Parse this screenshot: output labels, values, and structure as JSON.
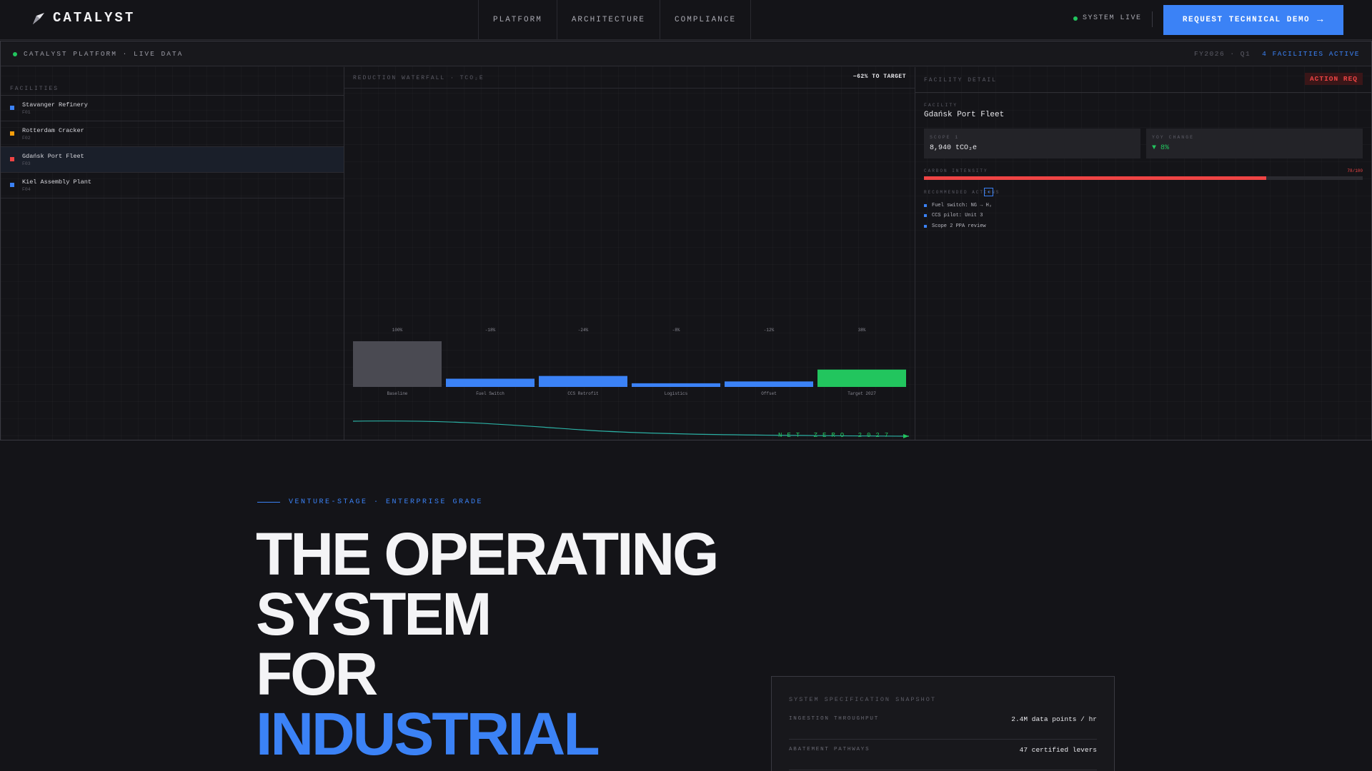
{
  "nav": {
    "brand": "CATALYST",
    "links": [
      "PLATFORM",
      "ARCHITECTURE",
      "COMPLIANCE"
    ],
    "status": "SYSTEM LIVE",
    "cta": "REQUEST TECHNICAL DEMO",
    "cta_arrow": "→"
  },
  "dashboard": {
    "title": "CATALYST PLATFORM · LIVE DATA",
    "period": "FY2026 · Q1",
    "active": "4 FACILITIES ACTIVE",
    "facilities_label": "FACILITIES",
    "facilities": [
      {
        "name": "Stavanger Refinery",
        "code": "F01",
        "color": "#3b82f6"
      },
      {
        "name": "Rotterdam Cracker",
        "code": "F02",
        "color": "#f59e0b"
      },
      {
        "name": "Gdańsk Port Fleet",
        "code": "F03",
        "color": "#ef4444"
      },
      {
        "name": "Kiel Assembly Plant",
        "code": "F04",
        "color": "#3b82f6"
      }
    ],
    "waterfall_label": "REDUCTION WATERFALL · TCO₂E",
    "target_tag": "−62% TO TARGET",
    "net_zero_label": "NET ZERO 2027",
    "detail": {
      "label": "FACILITY DETAIL",
      "badge": "ACTION REQ",
      "facility_label": "FACILITY",
      "facility_name": "Gdańsk Port Fleet",
      "scope_label": "SCOPE 1",
      "scope_value": "8,940 tCO₂e",
      "yoy_label": "YOY CHANGE",
      "yoy_value": "▼ 8%",
      "intensity_label": "CARBON INTENSITY",
      "intensity_value": "78/100",
      "intensity_fraction": 0.78,
      "actions_label": "RECOMMENDED ACTIONS",
      "actions": [
        "Fuel switch: NG → H₂",
        "CCS pilot: Unit 3",
        "Scope 2 PPA review"
      ]
    }
  },
  "chart_data": {
    "type": "bar",
    "title": "REDUCTION WATERFALL · TCO₂E",
    "categories": [
      "Baseline",
      "Fuel Switch",
      "CCS Retrofit",
      "Logistics",
      "Offset",
      "Target 2027"
    ],
    "values": [
      100,
      -18,
      -24,
      -8,
      -12,
      38
    ],
    "value_labels": [
      "100%",
      "-18%",
      "-24%",
      "-8%",
      "-12%",
      "38%"
    ],
    "colors": [
      "#4a4a52",
      "#3b82f6",
      "#3b82f6",
      "#3b82f6",
      "#3b82f6",
      "#22c55e"
    ],
    "ylim": [
      0,
      100
    ],
    "grid": true
  },
  "hero": {
    "eyebrow": "VENTURE-STAGE · ENTERPRISE GRADE",
    "line1": "THE OPERATING",
    "line2": "SYSTEM",
    "line3": "FOR",
    "line4": "INDUSTRIAL"
  },
  "spec": {
    "title": "SYSTEM SPECIFICATION SNAPSHOT",
    "rows": [
      {
        "k": "INGESTION THROUGHPUT",
        "v": "2.4M data points / hr"
      },
      {
        "k": "ABATEMENT PATHWAYS",
        "v": "47 certified levers"
      }
    ]
  },
  "colors": {
    "accent": "#3b82f6",
    "live": "#22c55e",
    "alert": "#ef4444",
    "bg": "#141418"
  }
}
